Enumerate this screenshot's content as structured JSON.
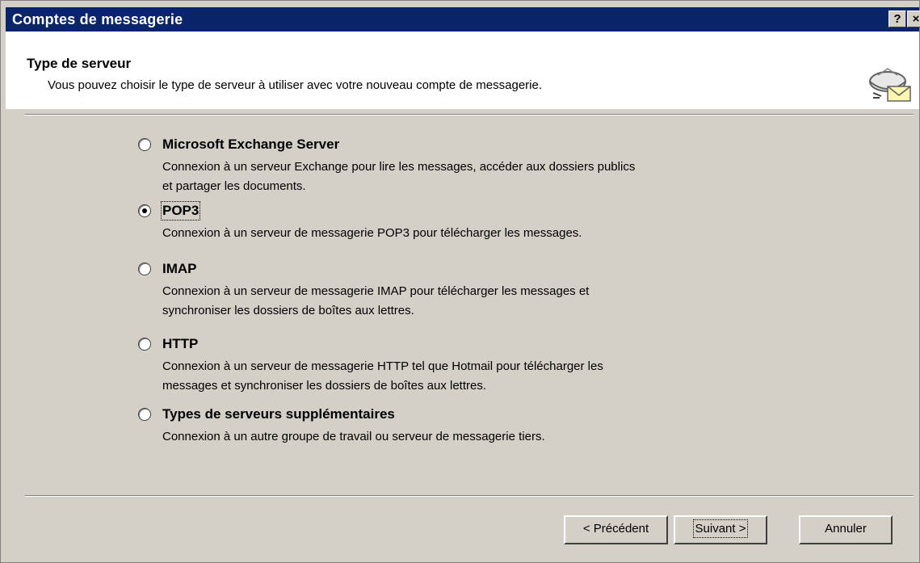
{
  "window": {
    "title": "Comptes de messagerie",
    "help_button": "?",
    "close_button": "×"
  },
  "header": {
    "title": "Type de serveur",
    "subtitle": "Vous pouvez choisir le type de serveur à utiliser avec votre nouveau compte de messagerie.",
    "icon": "mail-account-icon"
  },
  "options": [
    {
      "label": "Microsoft Exchange Server",
      "description_lines": [
        "Connexion à un serveur Exchange pour lire les messages, accéder aux dossiers publics",
        "et partager les documents."
      ],
      "selected": false
    },
    {
      "label": "POP3",
      "description_lines": [
        "Connexion à un serveur de messagerie POP3 pour télécharger les messages."
      ],
      "selected": true
    },
    {
      "label": "IMAP",
      "description_lines": [
        "Connexion à un serveur de messagerie IMAP pour télécharger les messages et",
        "synchroniser les dossiers de boîtes aux lettres."
      ],
      "selected": false
    },
    {
      "label": "HTTP",
      "description_lines": [
        "Connexion à un serveur de messagerie HTTP tel que Hotmail pour télécharger les",
        "messages et synchroniser les dossiers de boîtes aux lettres."
      ],
      "selected": false
    },
    {
      "label": "Types de serveurs supplémentaires",
      "description_lines": [
        "Connexion à un autre groupe de travail ou serveur de messagerie tiers."
      ],
      "selected": false
    }
  ],
  "buttons": {
    "previous": "< Précédent",
    "next": "Suivant >",
    "cancel": "Annuler"
  },
  "colors": {
    "titlebar": "#0a246a",
    "dialog_bg": "#d4d0c8",
    "header_bg": "#ffffff"
  }
}
